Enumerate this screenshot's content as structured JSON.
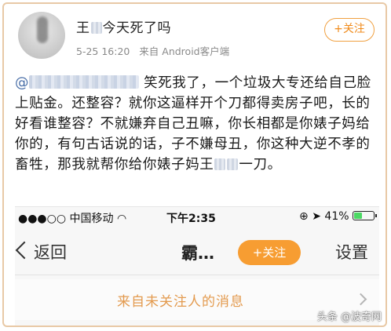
{
  "post": {
    "username_prefix": "王",
    "username_suffix": "今天死了吗",
    "timestamp": "5-25 16:20",
    "source": "来自 Android客户端",
    "follow_label": "+关注",
    "mention_at": "@",
    "text_part1": "笑死我了，一个垃圾大专还给自己脸上贴金。还整容？就你这逼样开个刀都得卖房子吧，长的好看谁整容？不就嫌弃自己丑嘛，你长相都是你婊子妈给你的，有句古话说的话，子不嫌母丑，你这种大逆不孝的畜牲，那我就帮你给你婊子妈王",
    "text_part2": "一刀。"
  },
  "phone": {
    "status": {
      "signal": "●●●○○",
      "carrier": "中国移动",
      "wifi": "◠",
      "time": "下午2:35",
      "lock_icon": "⊕",
      "location_icon": "➤",
      "battery_text": "41%"
    },
    "nav": {
      "back_label": "返回",
      "title": "霸…",
      "follow_label": "+关注",
      "settings_label": "设置"
    },
    "stranger_message": "来自未关注人的消息"
  },
  "watermark": "头条 @波奇网",
  "colors": {
    "accent_orange": "#f79d32",
    "stranger_text": "#e39a4e",
    "frame_border": "#e8c9a6"
  }
}
